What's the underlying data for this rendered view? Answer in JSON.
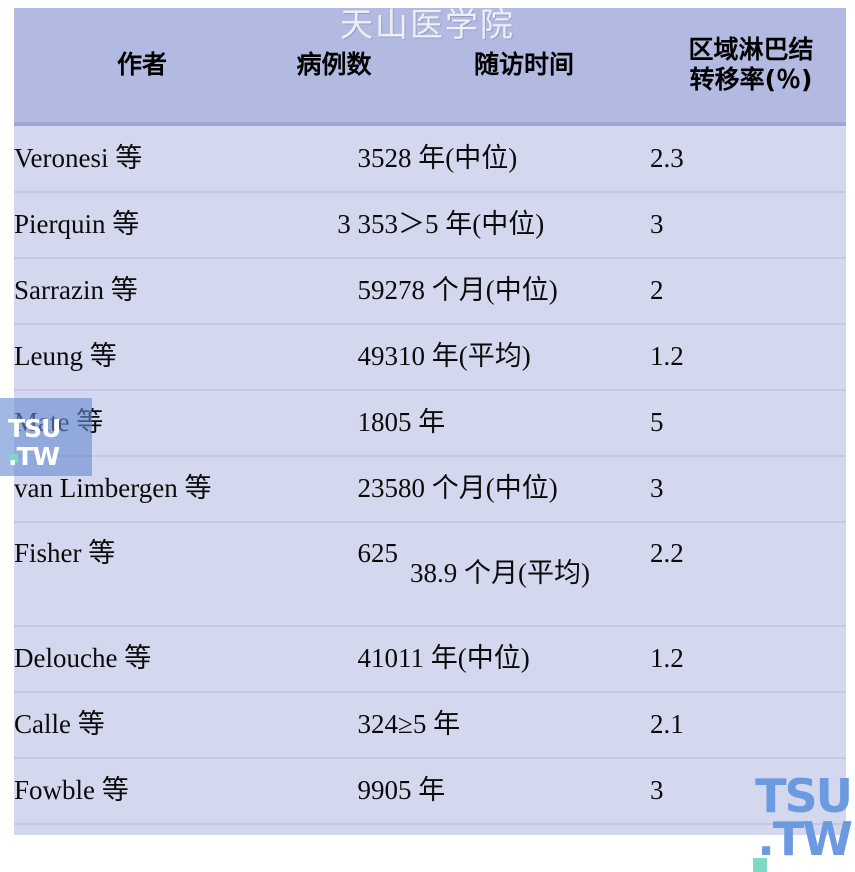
{
  "watermarks": {
    "top_title": "天山医学院",
    "left_badge_line1": "TSU",
    "left_badge_line2": ".TW",
    "bottom_right_line1": "TSU",
    "bottom_right_line2": ".TW"
  },
  "colors": {
    "header_bg": "#b3bae2",
    "row_bg": "#d4d8ee",
    "row_border": "#c2c8e6",
    "header_rule": "#9ea7d6",
    "text": "#0b0b0b",
    "watermark_blue": "#6b9ae0",
    "watermark_teal": "#7fd8c4"
  },
  "table": {
    "headers": {
      "author": "作者",
      "cases": "病例数",
      "followup": "随访时间",
      "rate_line1": "区域淋巴结",
      "rate_line2": "转移率(％)"
    },
    "rows": [
      {
        "author": "Veronesi 等",
        "cases": "352",
        "followup": "8 年(中位)",
        "rate": "2.3"
      },
      {
        "author": "Pierquin 等",
        "cases": "3 353",
        "followup": "＞5 年(中位)",
        "rate": "3"
      },
      {
        "author": "Sarrazin 等",
        "cases": "592",
        "followup": "78 个月(中位)",
        "rate": "2"
      },
      {
        "author": "Leung 等",
        "cases": "493",
        "followup": "10 年(平均)",
        "rate": "1.2"
      },
      {
        "author": "Mate 等",
        "cases": "180",
        "followup": "5 年",
        "rate": "5"
      },
      {
        "author": "van Limbergen 等",
        "cases": "235",
        "followup": "80 个月(中位)",
        "rate": "3"
      },
      {
        "author": "Fisher 等",
        "cases": "625",
        "followup": "38.9 个月(平均)",
        "rate": "2.2"
      },
      {
        "author": "Delouche 等",
        "cases": "410",
        "followup": "11 年(中位)",
        "rate": "1.2"
      },
      {
        "author": "Calle 等",
        "cases": "324",
        "followup": "≥5 年",
        "rate": "2.1"
      },
      {
        "author": "Fowble 等",
        "cases": "990",
        "followup": "5 年",
        "rate": "3"
      }
    ]
  }
}
